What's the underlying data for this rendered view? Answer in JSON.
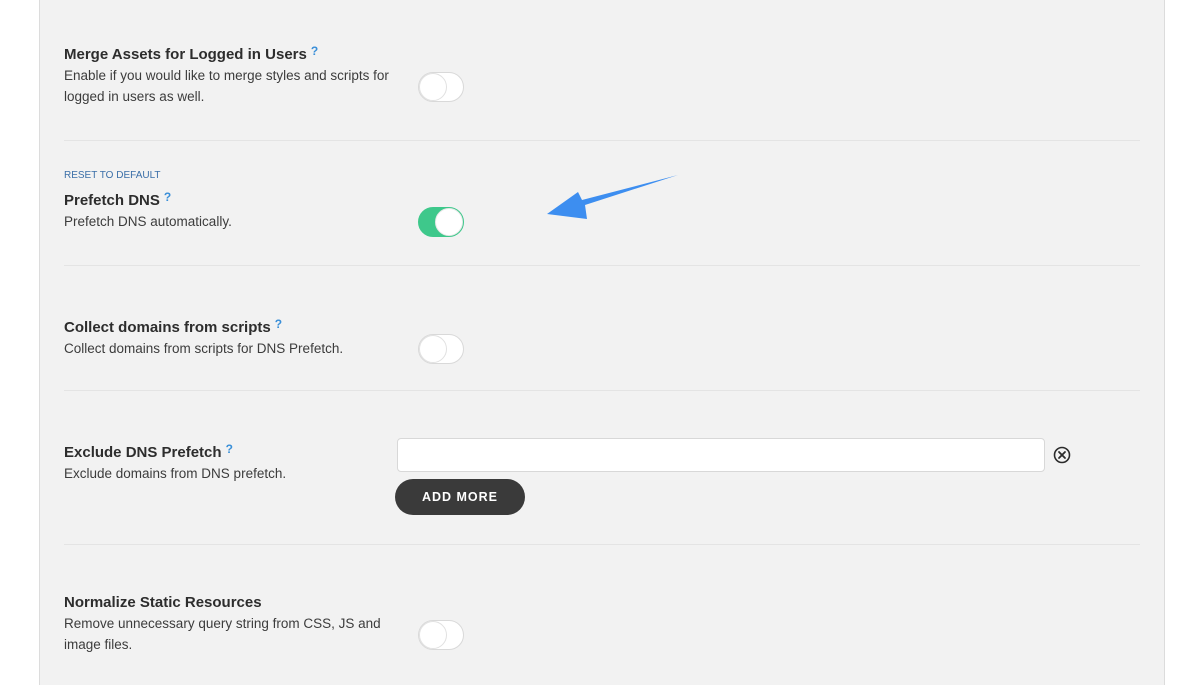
{
  "settings": [
    {
      "title": "Merge Assets for Logged in Users",
      "help": "?",
      "description": "Enable if you would like to merge styles and scripts for logged in users as well.",
      "enabled": false
    },
    {
      "reset_label": "RESET TO DEFAULT",
      "title": "Prefetch DNS",
      "help": "?",
      "description": "Prefetch DNS automatically.",
      "enabled": true
    },
    {
      "title": "Collect domains from scripts",
      "help": "?",
      "description": "Collect domains from scripts for DNS Prefetch.",
      "enabled": false
    },
    {
      "title": "Exclude DNS Prefetch",
      "help": "?",
      "description": "Exclude domains from DNS prefetch.",
      "input_value": "",
      "add_more_label": "ADD MORE"
    },
    {
      "title": "Normalize Static Resources",
      "description": "Remove unnecessary query string from CSS, JS and image files.",
      "enabled": false
    }
  ],
  "colors": {
    "toggle_on": "#3ec88b",
    "help_link": "#3a8fd8",
    "annotation_arrow": "#3d8ef0"
  },
  "icons": {
    "clear": "circle-x-icon",
    "annotation": "arrow-pointer-icon"
  }
}
